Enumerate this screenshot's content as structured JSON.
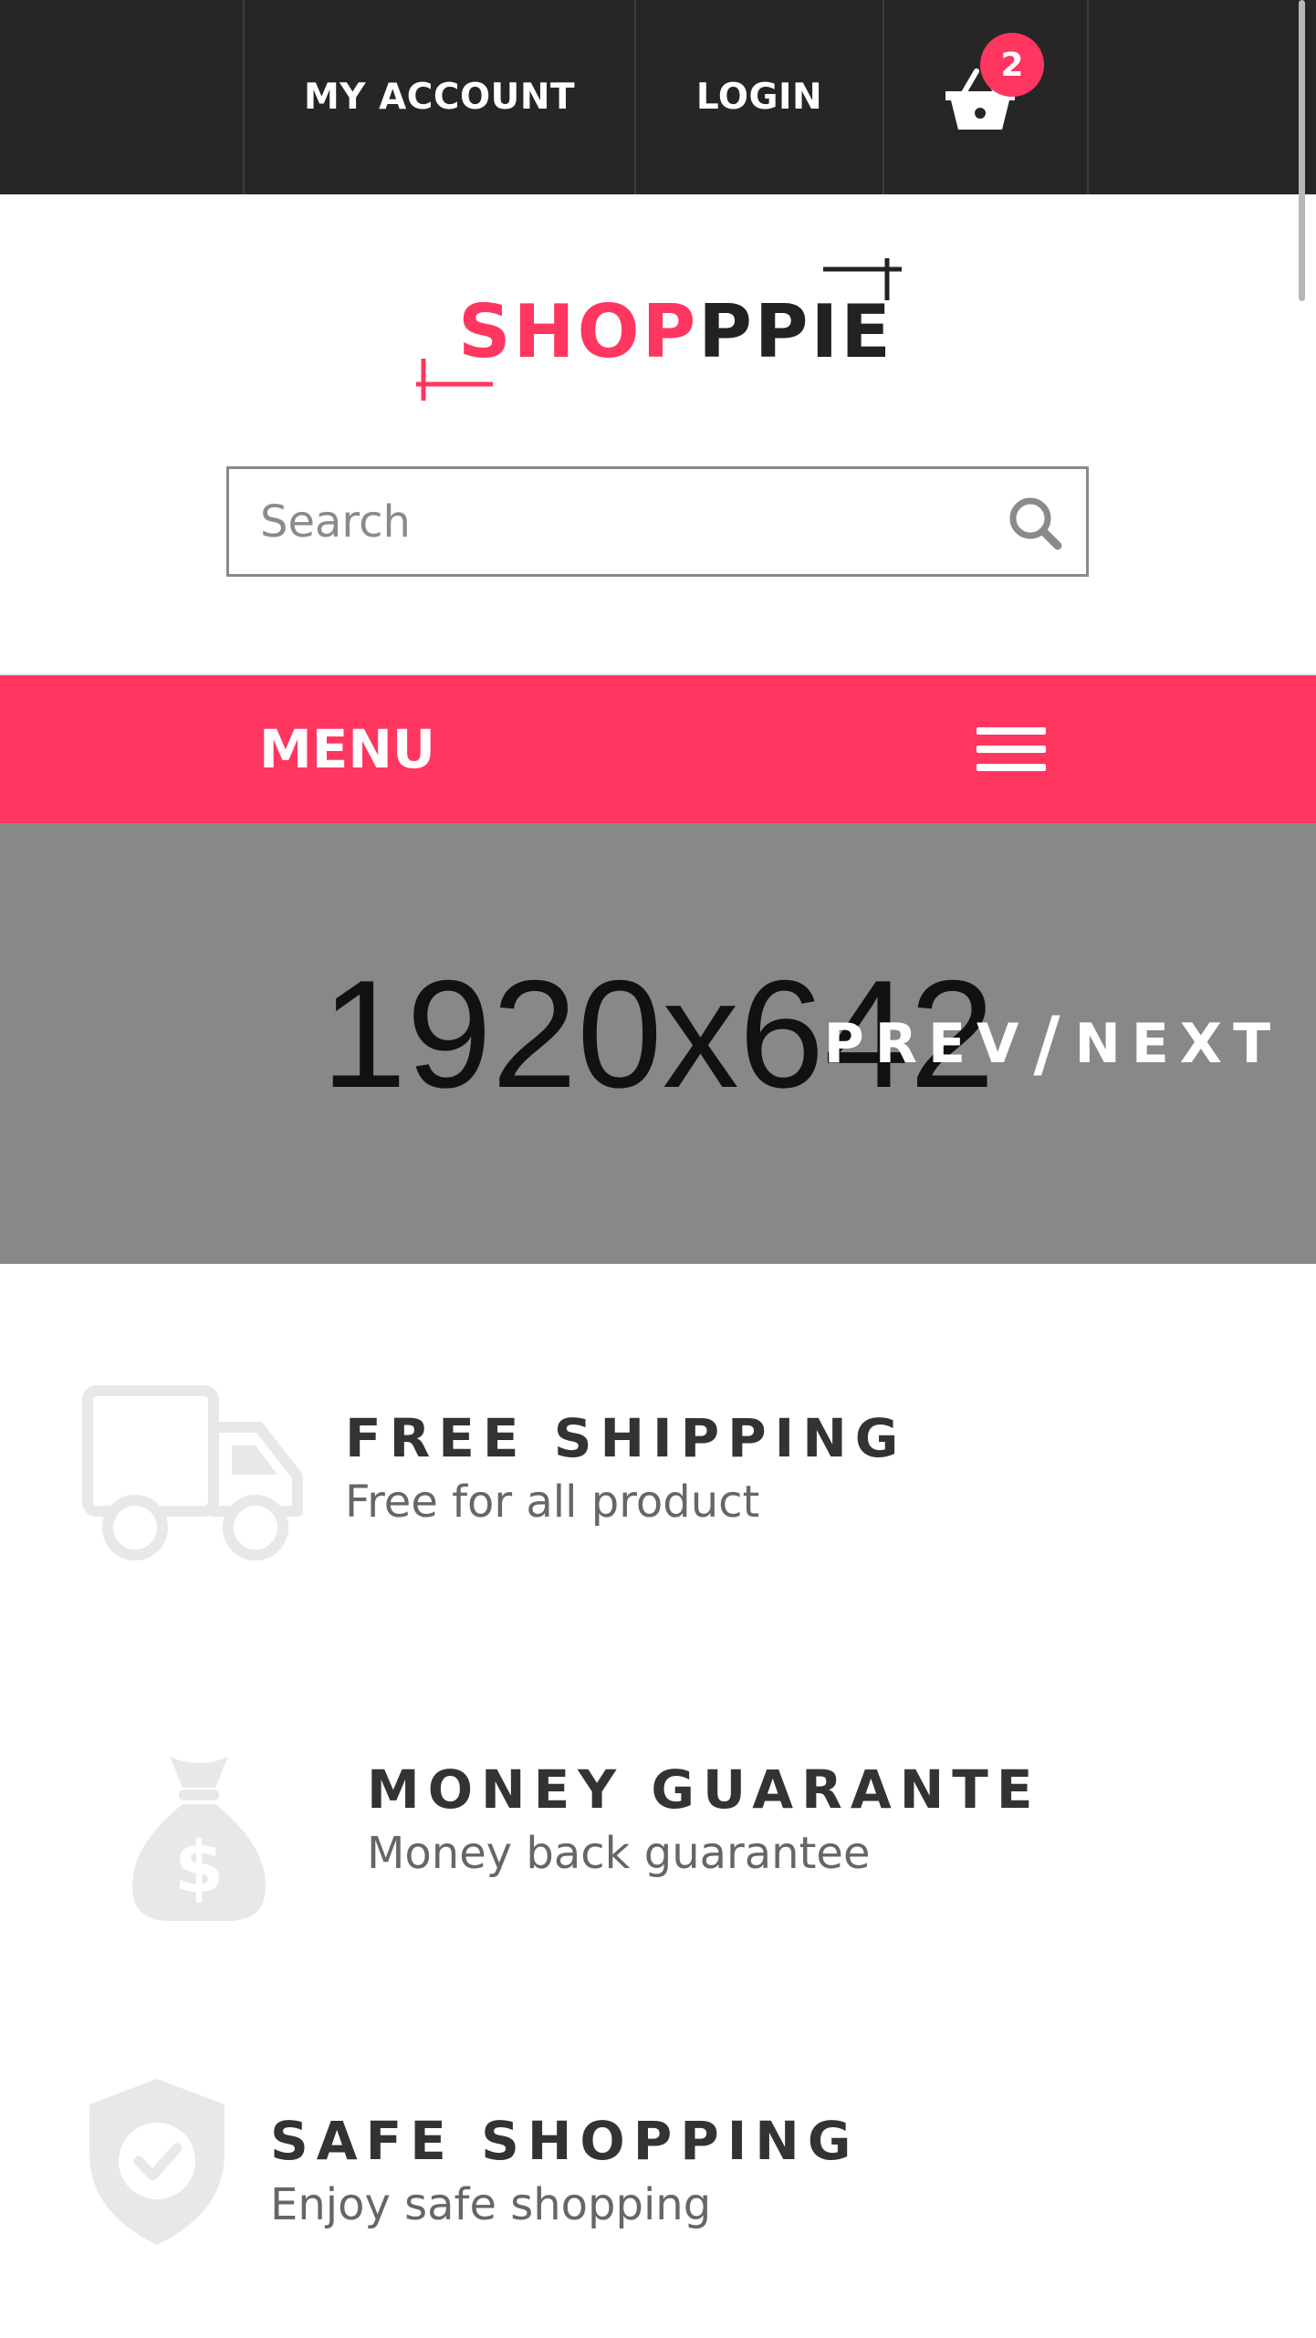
{
  "topbar": {
    "my_account": "MY ACCOUNT",
    "login": "LOGIN",
    "cart_count": "2"
  },
  "logo": {
    "part1": "SHOP",
    "part2": "PPIE"
  },
  "search": {
    "placeholder": "Search"
  },
  "menu": {
    "label": "MENU"
  },
  "slider": {
    "placeholder_text": "1920x642",
    "prev": "PREV",
    "separator": "/",
    "next": "NEXT"
  },
  "features": [
    {
      "icon": "truck-icon",
      "title": "FREE SHIPPING",
      "subtitle": "Free for all product"
    },
    {
      "icon": "money-bag-icon",
      "title": "MONEY GUARANTE",
      "subtitle": "Money back guarantee"
    },
    {
      "icon": "shield-check-icon",
      "title": "SAFE SHOPPING",
      "subtitle": "Enjoy safe shopping"
    }
  ],
  "colors": {
    "brand": "#fe3660",
    "topbar": "#262626",
    "slider_bg": "#888888"
  }
}
